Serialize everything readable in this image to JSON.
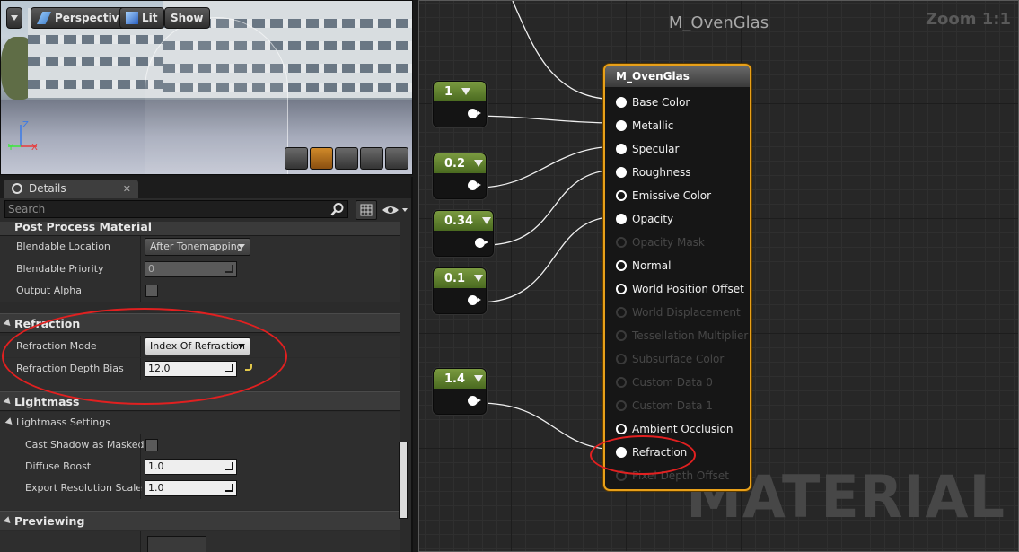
{
  "viewport": {
    "toolbar": {
      "perspective_label": "Perspective",
      "lit_label": "Lit",
      "show_label": "Show"
    },
    "axis": {
      "x": "X",
      "y": "Y",
      "z": "Z"
    },
    "preview_shapes": [
      "cylinder-icon",
      "sphere-icon",
      "plane-icon",
      "cube-icon",
      "teapot-icon"
    ]
  },
  "details": {
    "tab_label": "Details",
    "tab_close": "✕",
    "search_placeholder": "Search",
    "categories": {
      "post_process": "Post Process Material",
      "refraction": "Refraction",
      "lightmass": "Lightmass",
      "lightmass_settings": "Lightmass Settings",
      "previewing": "Previewing"
    },
    "post_process": {
      "blendable_location_label": "Blendable Location",
      "blendable_location_value": "After Tonemapping",
      "blendable_priority_label": "Blendable Priority",
      "blendable_priority_value": "0",
      "output_alpha_label": "Output Alpha"
    },
    "refraction": {
      "mode_label": "Refraction Mode",
      "mode_value": "Index Of Refraction",
      "depth_bias_label": "Refraction Depth Bias",
      "depth_bias_value": "12.0"
    },
    "lightmass": {
      "cast_shadow_label": "Cast Shadow as Masked",
      "diffuse_boost_label": "Diffuse Boost",
      "diffuse_boost_value": "1.0",
      "export_res_label": "Export Resolution Scale",
      "export_res_value": "1.0"
    },
    "annotation_color": "#e12020"
  },
  "graph": {
    "title": "M_OvenGlas",
    "zoom": "Zoom 1:1",
    "watermark": "MATERIAL",
    "constants": [
      "1",
      "0.2",
      "0.34",
      "0.1",
      "1.4"
    ],
    "const_color": "#6a8a30",
    "material_node": {
      "title": "M_OvenGlas",
      "border_color": "#e8a019",
      "pins": [
        {
          "label": "Base Color",
          "state": "connected"
        },
        {
          "label": "Metallic",
          "state": "connected"
        },
        {
          "label": "Specular",
          "state": "connected"
        },
        {
          "label": "Roughness",
          "state": "connected"
        },
        {
          "label": "Emissive Color",
          "state": "open"
        },
        {
          "label": "Opacity",
          "state": "connected"
        },
        {
          "label": "Opacity Mask",
          "state": "disabled"
        },
        {
          "label": "Normal",
          "state": "open"
        },
        {
          "label": "World Position Offset",
          "state": "open"
        },
        {
          "label": "World Displacement",
          "state": "disabled"
        },
        {
          "label": "Tessellation Multiplier",
          "state": "disabled"
        },
        {
          "label": "Subsurface Color",
          "state": "disabled"
        },
        {
          "label": "Custom Data 0",
          "state": "disabled"
        },
        {
          "label": "Custom Data 1",
          "state": "disabled"
        },
        {
          "label": "Ambient Occlusion",
          "state": "open"
        },
        {
          "label": "Refraction",
          "state": "connected"
        },
        {
          "label": "Pixel Depth Offset",
          "state": "disabled"
        }
      ]
    }
  }
}
